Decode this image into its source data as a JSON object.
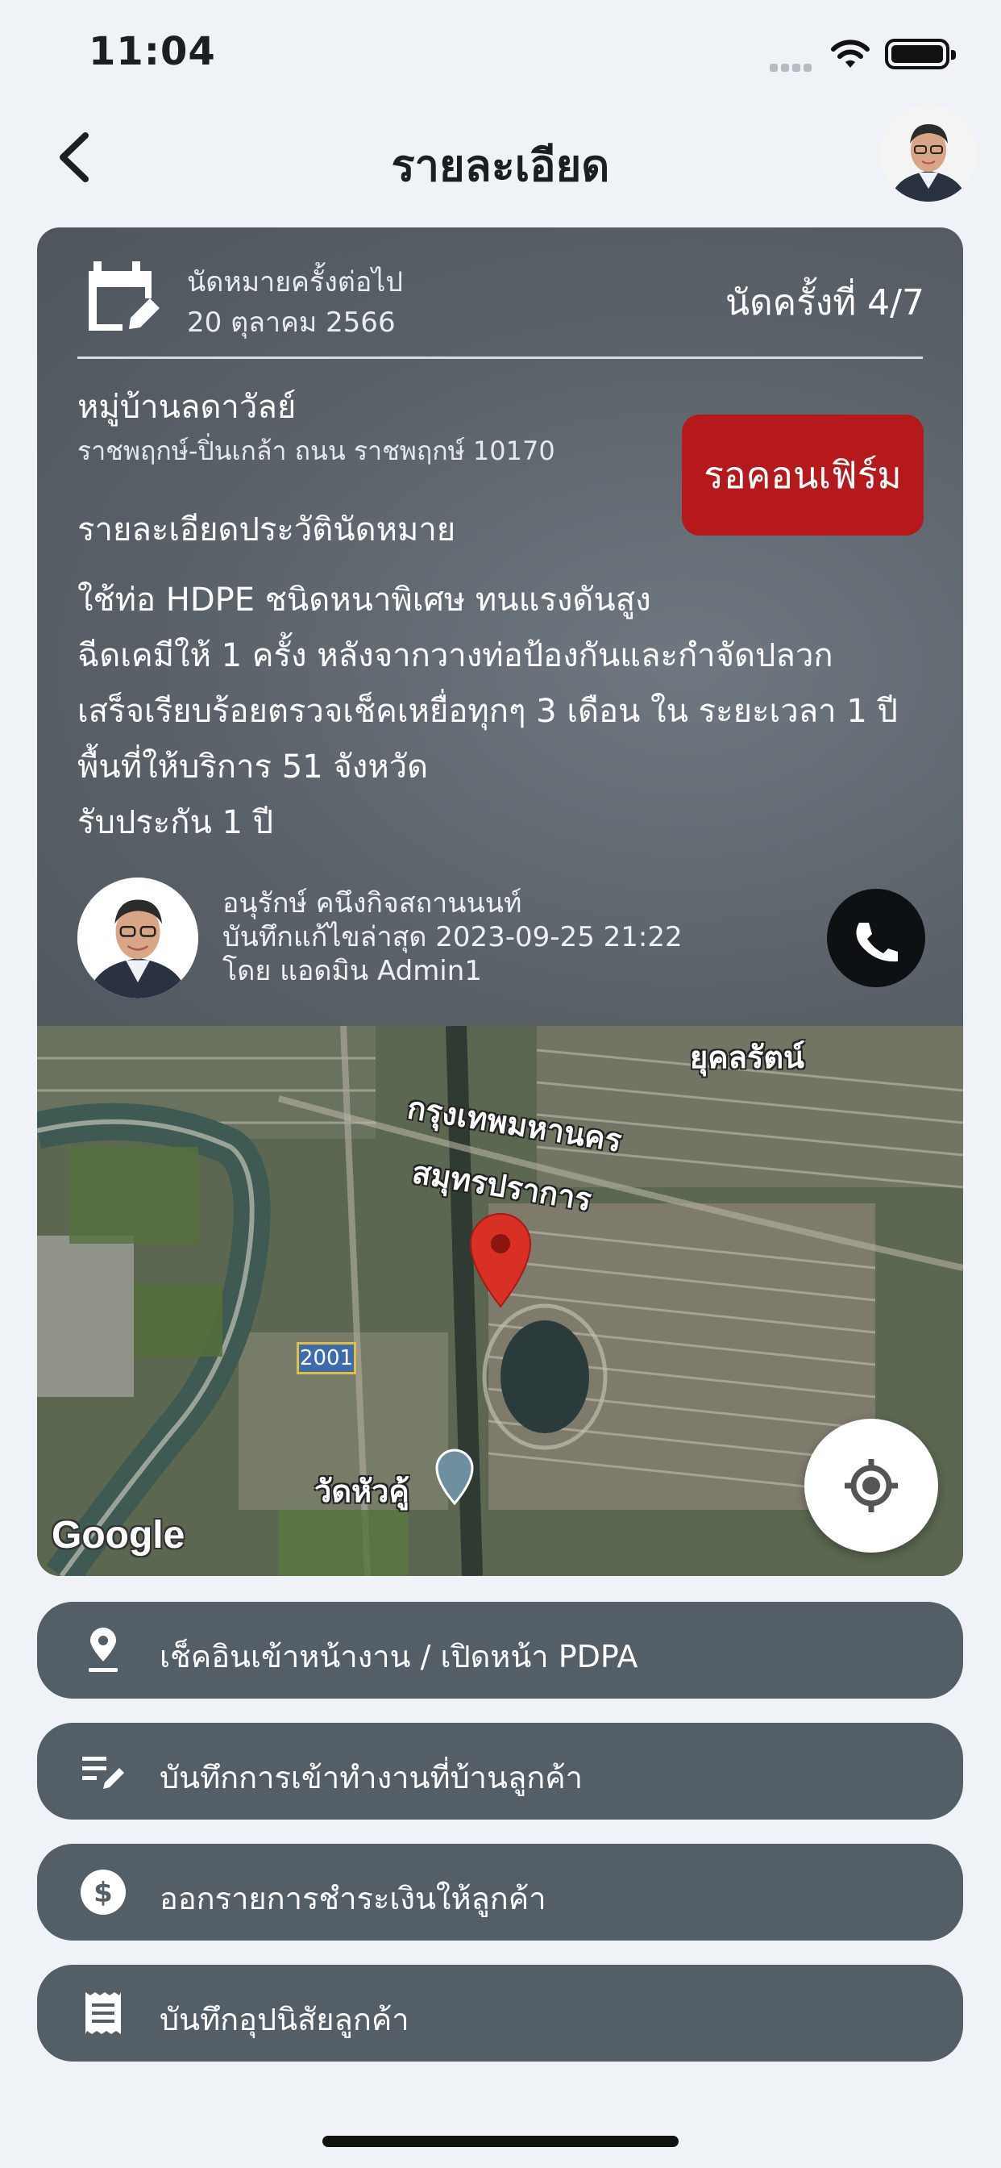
{
  "status_bar": {
    "time": "11:04"
  },
  "header": {
    "title": "รายละเอียด"
  },
  "appointment": {
    "next_label": "นัดหมายครั้งต่อไป",
    "next_date": "20 ตุลาคม 2566",
    "count_label": "นัดครั้งที่ 4/7",
    "village": "หมู่บ้านลดาวัลย์",
    "address": "ราชพฤกษ์-ปิ่นเกล้า ถนน ราชพฤกษ์  10170",
    "status_badge": "รอคอนเฟิร์ม",
    "status_color": "#b5191c",
    "history_label": "รายละเอียดประวัตินัดหมาย",
    "details": [
      "ใช้ท่อ HDPE ชนิดหนาพิเศษ ทนแรงดันสูง",
      "ฉีดเคมีให้  1 ครั้ง หลังจากวางท่อป้องกันและกำจัดปลวก",
      "เสร็จเรียบร้อยตรวจเช็คเหยื่อทุกๆ  3 เดือน ใน ระยะเวลา 1  ปี",
      "พื้นที่ให้บริการ 51 จังหวัด",
      "รับประกัน 1 ปี"
    ]
  },
  "staff": {
    "name": "อนุรักษ์ คนึงกิจสถานนนท์",
    "updated": "บันทึกแก้ไขล่าสุด 2023-09-25 21:22",
    "by": "โดย แอดมิน Admin1"
  },
  "map": {
    "labels": {
      "yukol": "ยุคลรัตน์",
      "bangkok": "กรุงเทพมหานคร",
      "samutprakan": "สมุทรปราการ",
      "wat": "วัดหัวคู้"
    },
    "road_number": "2001",
    "logo": "Google",
    "pin_color": "#d93025"
  },
  "actions": [
    {
      "label": "เช็คอินเข้าหน้างาน / เปิดหน้า PDPA",
      "icon": "location-pin-icon"
    },
    {
      "label": "บันทึกการเข้าทำงานที่บ้านลูกค้า",
      "icon": "edit-notes-icon"
    },
    {
      "label": "ออกรายการชำระเงินให้ลูกค้า",
      "icon": "dollar-circle-icon"
    },
    {
      "label": "บันทึกอุปนิสัยลูกค้า",
      "icon": "receipt-icon"
    }
  ],
  "colors": {
    "background": "#eff3f8",
    "card": "#5a6169",
    "action_button": "#545e67"
  }
}
